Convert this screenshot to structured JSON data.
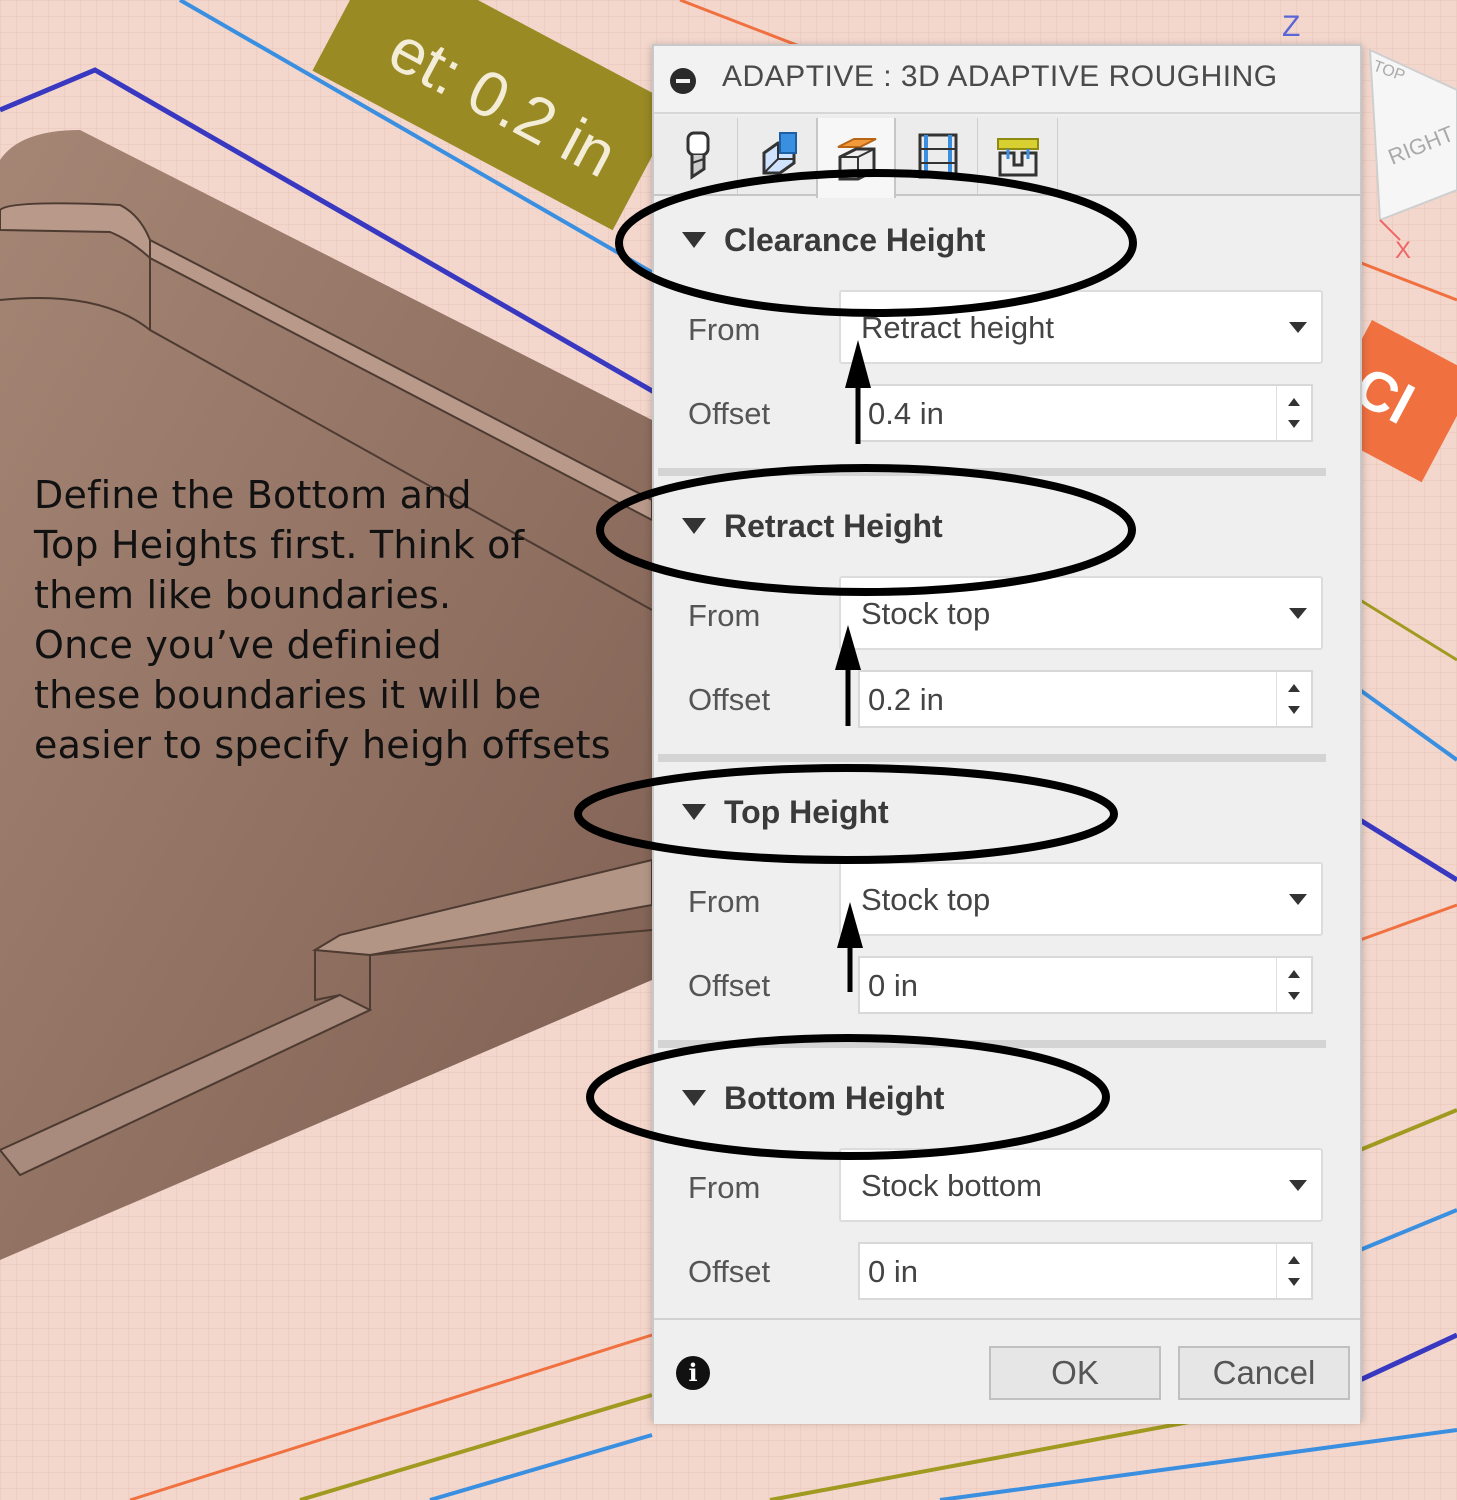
{
  "viewport": {
    "dimension_label": "et: 0.2 in",
    "orange_tag_text": "Cl",
    "viewcube": {
      "top_label": "TOP",
      "right_label": "RIGHT",
      "z_axis": "Z",
      "x_axis": "X"
    }
  },
  "annotation": {
    "text": "Define the Bottom and\nTop Heights first. Think of\nthem like boundaries.\nOnce you’ve definied\nthese boundaries it will be\neasier to specify heigh offsets"
  },
  "dialog": {
    "title": "ADAPTIVE : 3D ADAPTIVE ROUGHING",
    "tabs": [
      {
        "icon": "tool-icon",
        "active": false
      },
      {
        "icon": "geometry-icon",
        "active": false
      },
      {
        "icon": "heights-icon",
        "active": true
      },
      {
        "icon": "passes-icon",
        "active": false
      },
      {
        "icon": "linking-icon",
        "active": false
      }
    ],
    "sections": [
      {
        "title": "Clearance Height",
        "from_label": "From",
        "from_value": "Retract height",
        "offset_label": "Offset",
        "offset_value": "0.4 in"
      },
      {
        "title": "Retract Height",
        "from_label": "From",
        "from_value": "Stock top",
        "offset_label": "Offset",
        "offset_value": "0.2 in"
      },
      {
        "title": "Top Height",
        "from_label": "From",
        "from_value": "Stock top",
        "offset_label": "Offset",
        "offset_value": "0 in"
      },
      {
        "title": "Bottom Height",
        "from_label": "From",
        "from_value": "Stock bottom",
        "offset_label": "Offset",
        "offset_value": "0 in"
      }
    ],
    "footer": {
      "info_glyph": "i",
      "ok_label": "OK",
      "cancel_label": "Cancel"
    }
  },
  "colors": {
    "grid_background": "#f3d7cd",
    "part_brown": "#9b7a69",
    "blue_line": "#3a8fe0",
    "navy_line": "#3838c0",
    "orange_line": "#f07040",
    "olive_line": "#a09a20",
    "dimension_tag": "#9a8a24",
    "annotation_ink": "#111111"
  }
}
